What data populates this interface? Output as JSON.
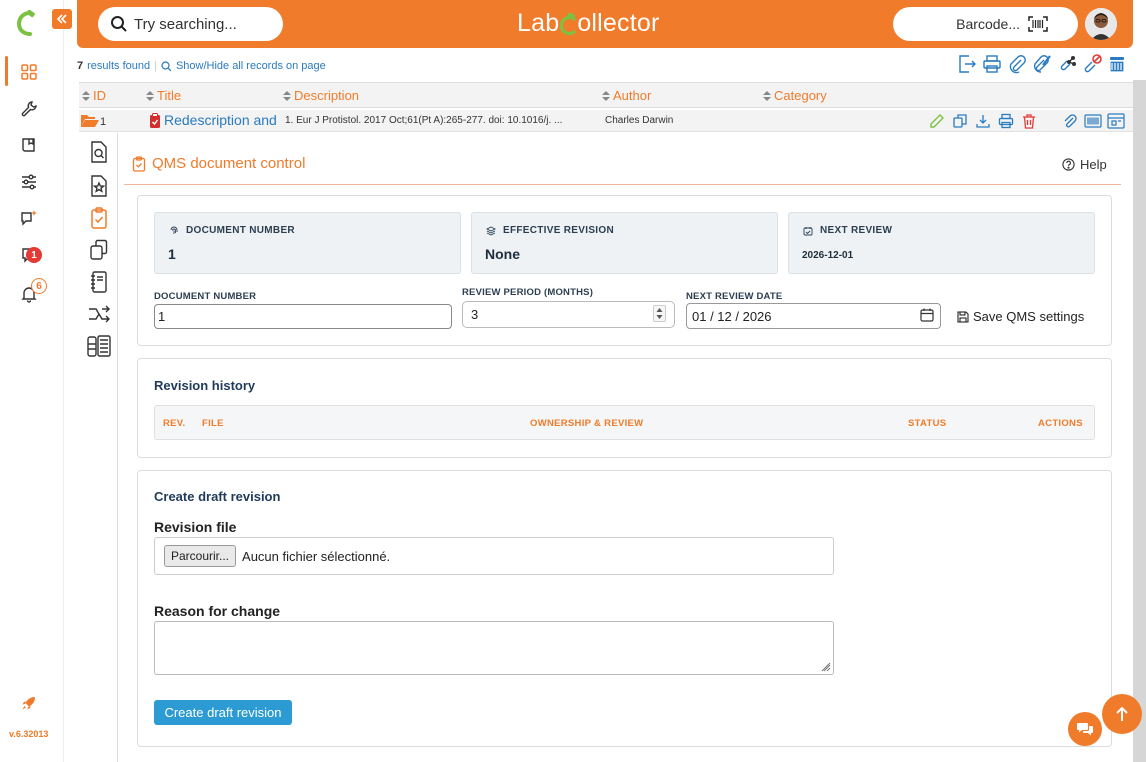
{
  "app": {
    "brand_prefix": "Lab",
    "brand_suffix": "ollector",
    "version": "v.6.32013"
  },
  "sidebar": {
    "messages_badge": "1",
    "notifications_badge": "6"
  },
  "header": {
    "search_placeholder": "Try searching...",
    "barcode_placeholder": "Barcode..."
  },
  "results": {
    "count": "7",
    "found_label": "results found",
    "toggle_label": "Show/Hide all records on page"
  },
  "table": {
    "columns": [
      "ID",
      "Title",
      "Description",
      "Author",
      "Category"
    ],
    "row": {
      "id": "1",
      "title": "Redescription and",
      "description": "1. Eur J Protistol. 2017 Oct;61(Pt A):265-277. doi: 10.1016/j. ...",
      "author": "Charles Darwin"
    }
  },
  "qms": {
    "title": "QMS document control",
    "help": "Help",
    "stats": [
      {
        "label": "DOCUMENT NUMBER",
        "value": "1"
      },
      {
        "label": "EFFECTIVE REVISION",
        "value": "None"
      },
      {
        "label": "NEXT REVIEW",
        "value": "2026-12-01"
      }
    ],
    "form": {
      "doc_number_label": "DOCUMENT NUMBER",
      "doc_number_value": "1",
      "review_period_label": "REVIEW PERIOD (MONTHS)",
      "review_period_value": "3",
      "next_review_label": "NEXT REVIEW DATE",
      "next_review_value": "01 / 12 / 2026",
      "save_label": "Save QMS settings"
    },
    "revision_history": {
      "title": "Revision history",
      "columns": [
        "REV.",
        "FILE",
        "OWNERSHIP & REVIEW",
        "STATUS",
        "ACTIONS"
      ]
    },
    "draft": {
      "title": "Create draft revision",
      "file_label": "Revision file",
      "browse_label": "Parcourir...",
      "no_file_text": "Aucun fichier sélectionné.",
      "reason_label": "Reason for change",
      "reason_value": "",
      "submit_label": "Create draft revision"
    }
  },
  "colors": {
    "accent": "#f07b2a",
    "link": "#2a7bbf",
    "button": "#2c9bd3",
    "heading": "#1f3a5a"
  }
}
